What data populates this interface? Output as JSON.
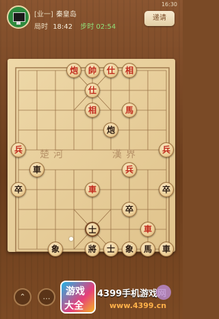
{
  "status": {
    "clock": "16:30"
  },
  "player": {
    "rank": "[业一]",
    "name": "秦皇岛",
    "total_label": "局时",
    "total_time": "18:42",
    "step_label": "步时",
    "step_time": "02:54"
  },
  "buttons": {
    "hurry": "递请"
  },
  "board": {
    "river_left": "楚河",
    "river_right": "漢界",
    "pieces": [
      {
        "char": "炮",
        "side": "red"
      },
      {
        "char": "帥",
        "side": "red"
      },
      {
        "char": "仕",
        "side": "red"
      },
      {
        "char": "相",
        "side": "red"
      },
      {
        "char": "仕",
        "side": "red"
      },
      {
        "char": "相",
        "side": "red"
      },
      {
        "char": "馬",
        "side": "red"
      },
      {
        "char": "炮",
        "side": "black"
      },
      {
        "char": "兵",
        "side": "red"
      },
      {
        "char": "兵",
        "side": "red"
      },
      {
        "char": "車",
        "side": "black"
      },
      {
        "char": "兵",
        "side": "red"
      },
      {
        "char": "卒",
        "side": "black"
      },
      {
        "char": "車",
        "side": "red"
      },
      {
        "char": "卒",
        "side": "black"
      },
      {
        "char": "卒",
        "side": "black"
      },
      {
        "char": "士",
        "side": "black",
        "selected": true
      },
      {
        "char": "車",
        "side": "red"
      },
      {
        "char": "象",
        "side": "black"
      },
      {
        "char": "將",
        "side": "black"
      },
      {
        "char": "士",
        "side": "black"
      },
      {
        "char": "象",
        "side": "black"
      },
      {
        "char": "馬",
        "side": "black"
      },
      {
        "char": "車",
        "side": "black"
      }
    ]
  },
  "footer": {
    "logo_top": "游戏",
    "logo_bottom": "大全",
    "brand": "4399手机游戏网",
    "url": "www.4399.cn"
  }
}
